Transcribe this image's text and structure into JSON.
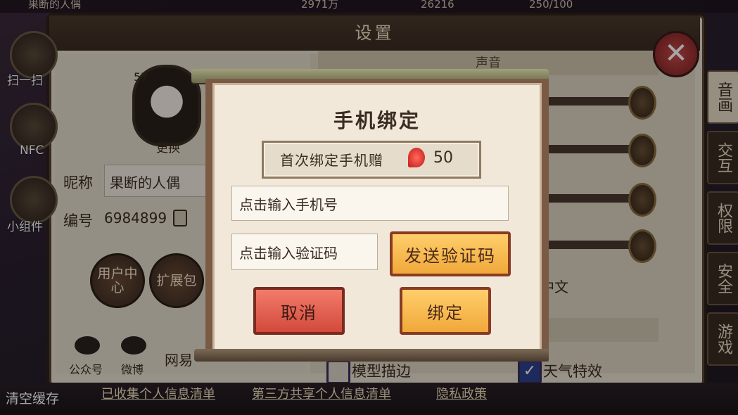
{
  "topbar": {
    "player_name": "果断的人偶",
    "coins": "2971万",
    "jade": "26216",
    "stamina": "250/100"
  },
  "settings": {
    "title": "设置",
    "sound_section": "声音",
    "level": "57",
    "change_avatar": "更换",
    "nickname_label": "昵称",
    "nickname_value": "果断的人偶",
    "id_label": "编号",
    "id_value": "6984899",
    "user_center": "用户中心",
    "extension_pack": "扩展包",
    "wechat": "公众号",
    "weibo": "微博",
    "netease": "网易",
    "language": "中文",
    "model_outline": "模型描边",
    "model_outline_checked": false,
    "weather_effects": "天气特效",
    "weather_effects_checked": true,
    "tabs": [
      "音画",
      "交互",
      "权限",
      "安全",
      "游戏"
    ],
    "active_tab": "音画",
    "close_icon": "close-icon"
  },
  "left_side": {
    "scan": "扫一扫",
    "nfc": "NFC",
    "widget": "小组件",
    "clear_cache": "清空缓存"
  },
  "bottom_links": [
    "已收集个人信息清单",
    "第三方共享个人信息清单",
    "隐私政策"
  ],
  "modal": {
    "title": "手机绑定",
    "reward_text": "首次绑定手机赠",
    "reward_icon": "magatama-icon",
    "reward_amount": "50",
    "phone_placeholder": "点击输入手机号",
    "code_placeholder": "点击输入验证码",
    "send_code": "发送验证码",
    "cancel": "取消",
    "bind": "绑定"
  },
  "colors": {
    "accent_orange": "#f0a83a",
    "cancel_red": "#d24a3c",
    "frame_brown": "#7a5a44"
  }
}
